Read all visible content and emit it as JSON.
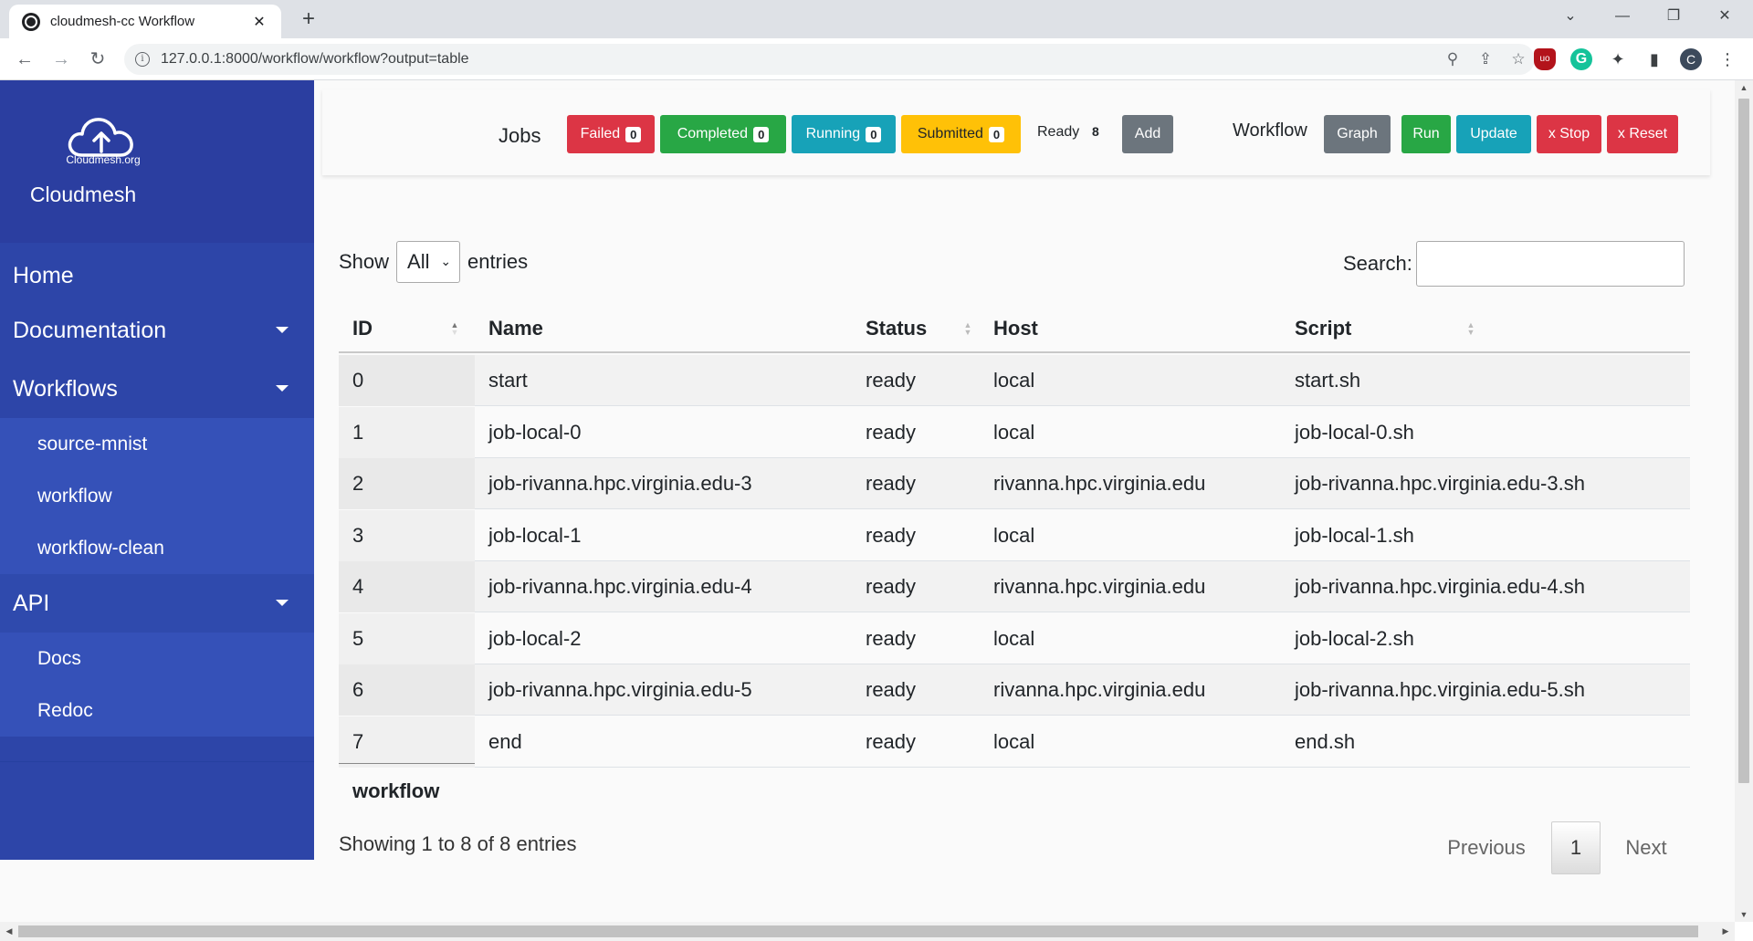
{
  "browser": {
    "tab_title": "cloudmesh-cc Workflow",
    "tab_close": "✕",
    "new_tab": "+",
    "url": "127.0.0.1:8000/workflow/workflow?output=table",
    "win_minimize": "—",
    "win_restore": "❐",
    "win_close": "✕",
    "tabs_dropdown": "⌄",
    "profile_initial": "C"
  },
  "sidebar": {
    "logo_text": "Cloudmesh.org",
    "brand_name": "Cloudmesh",
    "menu": {
      "home": "Home",
      "documentation": "Documentation",
      "workflows": "Workflows",
      "workflows_items": [
        "source-mnist",
        "workflow",
        "workflow-clean"
      ],
      "api": "API",
      "api_items": [
        "Docs",
        "Redoc"
      ]
    }
  },
  "jobs": {
    "label": "Jobs",
    "failed": {
      "label": "Failed",
      "count": "0",
      "color": "#dc3545"
    },
    "completed": {
      "label": "Completed",
      "count": "0",
      "color": "#28a745"
    },
    "running": {
      "label": "Running",
      "count": "0",
      "color": "#17a2b8"
    },
    "submitted": {
      "label": "Submitted",
      "count": "0",
      "color": "#ffc107"
    },
    "ready": {
      "label": "Ready",
      "count": "8"
    },
    "add": {
      "label": "Add",
      "color": "#6c757d"
    }
  },
  "workflow_controls": {
    "label": "Workflow",
    "graph": {
      "label": "Graph",
      "color": "#6c757d"
    },
    "run": {
      "label": "Run",
      "color": "#28a745"
    },
    "update": {
      "label": "Update",
      "color": "#17a2b8"
    },
    "stop": {
      "label": "x Stop",
      "color": "#dc3545"
    },
    "reset": {
      "label": "x Reset",
      "color": "#dc3545"
    }
  },
  "table_controls": {
    "show_label": "Show",
    "show_value": "All",
    "entries_label": "entries",
    "search_label": "Search:",
    "search_value": ""
  },
  "table": {
    "columns": [
      "ID",
      "Name",
      "Status",
      "Host",
      "Script"
    ],
    "rows": [
      [
        "0",
        "start",
        "ready",
        "local",
        "start.sh"
      ],
      [
        "1",
        "job-local-0",
        "ready",
        "local",
        "job-local-0.sh"
      ],
      [
        "2",
        "job-rivanna.hpc.virginia.edu-3",
        "ready",
        "rivanna.hpc.virginia.edu",
        "job-rivanna.hpc.virginia.edu-3.sh"
      ],
      [
        "3",
        "job-local-1",
        "ready",
        "local",
        "job-local-1.sh"
      ],
      [
        "4",
        "job-rivanna.hpc.virginia.edu-4",
        "ready",
        "rivanna.hpc.virginia.edu",
        "job-rivanna.hpc.virginia.edu-4.sh"
      ],
      [
        "5",
        "job-local-2",
        "ready",
        "local",
        "job-local-2.sh"
      ],
      [
        "6",
        "job-rivanna.hpc.virginia.edu-5",
        "ready",
        "rivanna.hpc.virginia.edu",
        "job-rivanna.hpc.virginia.edu-5.sh"
      ],
      [
        "7",
        "end",
        "ready",
        "local",
        "end.sh"
      ]
    ],
    "caption": "workflow",
    "info": "Showing 1 to 8 of 8 entries"
  },
  "pagination": {
    "previous": "Previous",
    "current": "1",
    "next": "Next"
  },
  "icons": {
    "back": "back-arrow-icon",
    "forward": "forward-arrow-icon",
    "reload": "reload-icon",
    "zoom": "zoom-icon",
    "share": "share-icon",
    "bookmark": "star-icon",
    "extensions": "puzzle-icon",
    "menu": "kebab-menu-icon"
  }
}
